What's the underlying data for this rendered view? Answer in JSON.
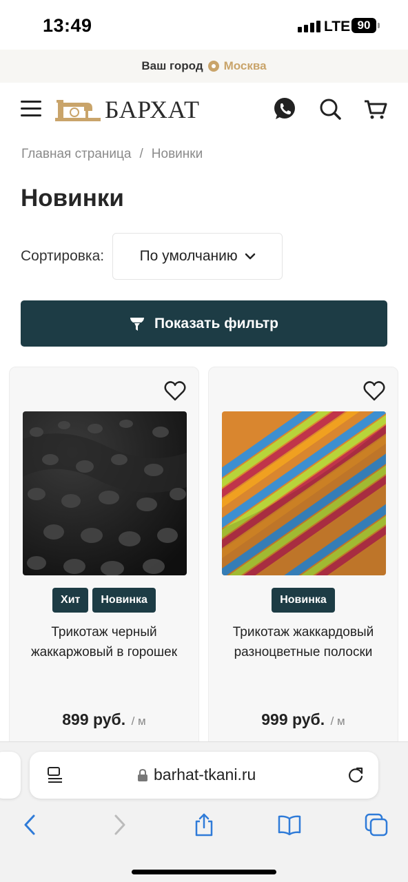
{
  "status": {
    "time": "13:49",
    "network": "LTE",
    "battery": "90"
  },
  "city": {
    "label": "Ваш город",
    "name": "Москва"
  },
  "header": {
    "logo_text": "БАРХАТ",
    "icons": [
      "menu-icon",
      "whatsapp-icon",
      "search-icon",
      "cart-icon"
    ]
  },
  "breadcrumb": {
    "home": "Главная страница",
    "separator": "/",
    "current": "Новинки"
  },
  "page_title": "Новинки",
  "sort": {
    "label": "Сортировка:",
    "value": "По умолчанию"
  },
  "filter_button": "Показать фильтр",
  "products": [
    {
      "badges": [
        "Хит",
        "Новинка"
      ],
      "name": "Трикотаж черный жаккаржовый в горошек",
      "price": "899 руб.",
      "unit": "/ м"
    },
    {
      "badges": [
        "Новинка"
      ],
      "name": "Трикотаж жаккардовый разноцветные полоски",
      "price": "999 руб.",
      "unit": "/ м"
    }
  ],
  "browser": {
    "url": "barhat-tkani.ru"
  },
  "colors": {
    "accent": "#1d3c45",
    "gold": "#c9a46a"
  }
}
